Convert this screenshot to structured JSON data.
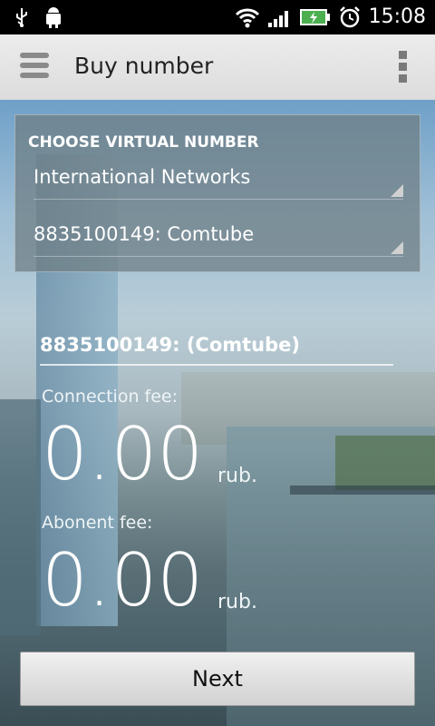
{
  "status_bar": {
    "time": "15:08",
    "icons": [
      "usb-icon",
      "android-debug-icon",
      "wifi-icon",
      "signal-icon",
      "battery-charging-icon",
      "alarm-icon"
    ]
  },
  "app_bar": {
    "title": "Buy number",
    "menu_icon": "hamburger-menu-icon",
    "overflow_icon": "overflow-menu-icon"
  },
  "choose_panel": {
    "title": "CHOOSE VIRTUAL NUMBER",
    "network_selected": "International Networks",
    "number_selected": "8835100149: Comtube"
  },
  "selected_number": "8835100149: (Comtube)",
  "connection_fee": {
    "label": "Connection fee:",
    "value": "0.00",
    "unit": "rub."
  },
  "abonent_fee": {
    "label": "Abonent fee:",
    "value": "0.00",
    "unit": "rub."
  },
  "next_button": "Next",
  "colors": {
    "status_bar": "#000000",
    "app_bar": "#e4e4e4",
    "panel": "#6e7d82"
  }
}
